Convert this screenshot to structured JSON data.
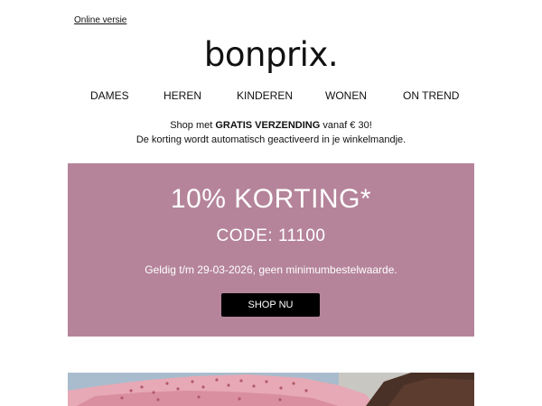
{
  "header": {
    "online_link": "Online versie",
    "logo": "bonprix."
  },
  "nav": {
    "items": [
      "DAMES",
      "HEREN",
      "KINDEREN",
      "WONEN",
      "ON TREND"
    ]
  },
  "shipping": {
    "prefix": "Shop met ",
    "bold": "GRATIS VERZENDING",
    "suffix": " vanaf € 30!",
    "line2": "De korting wordt automatisch geactiveerd in je winkelmandje."
  },
  "promo": {
    "title": "10% KORTING*",
    "code": "CODE: 11100",
    "validity": "Geldig t/m 29-03-2026, geen minimumbestelwaarde.",
    "button_label": "SHOP NU",
    "background_color": "#b5849a",
    "button_color": "#000000"
  },
  "hero": {
    "image": "fashion-photo-pink-eyelet-top"
  }
}
